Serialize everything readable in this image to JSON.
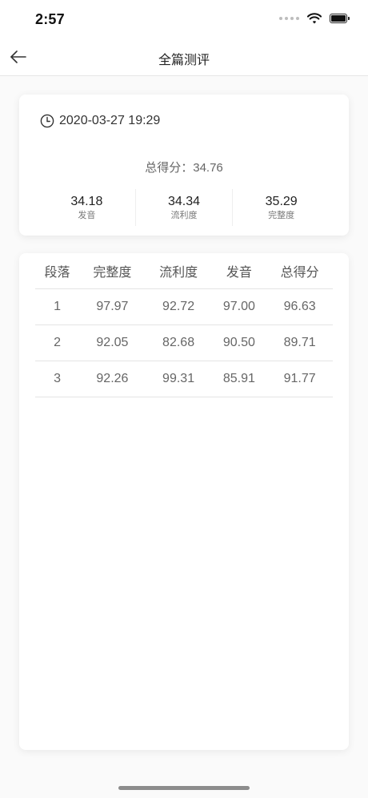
{
  "status_bar": {
    "time": "2:57"
  },
  "nav": {
    "title": "全篇测评",
    "back_icon": "arrow-left-icon"
  },
  "summary": {
    "datetime": "2020-03-27 19:29",
    "total_label": "总得分：",
    "total_value": "34.76",
    "metrics": [
      {
        "value": "34.18",
        "label": "发音"
      },
      {
        "value": "34.34",
        "label": "流利度"
      },
      {
        "value": "35.29",
        "label": "完整度"
      }
    ]
  },
  "table": {
    "headers": [
      "段落",
      "完整度",
      "流利度",
      "发音",
      "总得分"
    ],
    "rows": [
      [
        "1",
        "97.97",
        "92.72",
        "97.00",
        "96.63"
      ],
      [
        "2",
        "92.05",
        "82.68",
        "90.50",
        "89.71"
      ],
      [
        "3",
        "92.26",
        "99.31",
        "85.91",
        "91.77"
      ]
    ]
  }
}
